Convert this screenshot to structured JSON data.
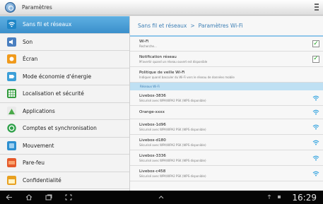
{
  "window": {
    "title": "Paramètres"
  },
  "sidebar": {
    "items": [
      {
        "label": "Sans fil et réseaux",
        "active": true,
        "icon": "wifi-icon",
        "color": "#3aa6e0"
      },
      {
        "label": "Son",
        "icon": "speaker-icon",
        "color": "#4a7fc0"
      },
      {
        "label": "Écran",
        "icon": "brightness-icon",
        "color": "#f09a1c"
      },
      {
        "label": "Mode économie d'énergie",
        "icon": "battery-icon",
        "color": "#3c9fd8"
      },
      {
        "label": "Localisation et sécurité",
        "icon": "grid-lock-icon",
        "color": "#2f9a3a"
      },
      {
        "label": "Applications",
        "icon": "apps-icon",
        "color": "#4aa94a"
      },
      {
        "label": "Comptes et synchronisation",
        "icon": "sync-icon",
        "color": "#2fa14a"
      },
      {
        "label": "Mouvement",
        "icon": "motion-icon",
        "color": "#2d8fd0"
      },
      {
        "label": "Pare-feu",
        "icon": "firewall-icon",
        "color": "#e55a2b"
      },
      {
        "label": "Confidentialité",
        "icon": "privacy-icon",
        "color": "#e8a020"
      }
    ]
  },
  "main": {
    "breadcrumb": {
      "parent": "Sans fil et réseaux",
      "separator": ">",
      "current": "Paramètres Wi-Fi"
    },
    "settings": [
      {
        "title": "Wi-Fi",
        "subtitle": "Recherche...",
        "checked": true
      },
      {
        "title": "Notification réseau",
        "subtitle": "M'avertir quand un réseau ouvert est disponible",
        "checked": true
      },
      {
        "title": "Politique de veille Wi-Fi",
        "subtitle": "Indiquer quand basculer du Wi-Fi vers le réseau de données mobile"
      }
    ],
    "section_header": "Réseaux Wi-Fi",
    "networks": [
      {
        "name": "Livebox-3836",
        "detail": "Sécurisé avec WPA/WPA2 PSK (WPS disponible)"
      },
      {
        "name": "Orange-xxxx",
        "detail": ""
      },
      {
        "name": "Livebox-1d96",
        "detail": "Sécurisé avec WPA/WPA2 PSK (WPS disponible)"
      },
      {
        "name": "Livebox-d180",
        "detail": "Sécurisé avec WPA/WPA2 PSK (WPS disponible)"
      },
      {
        "name": "Livebox-3336",
        "detail": "Sécurisé avec WPA/WPA2 PSK (WPS disponible)"
      },
      {
        "name": "Livebox-c458",
        "detail": "Sécurisé avec WPA/WPA2 PSK (WPS disponible)"
      }
    ],
    "checkmark": "✓"
  },
  "statusbar": {
    "time": "16:29",
    "accent": "#3aa6e0"
  }
}
